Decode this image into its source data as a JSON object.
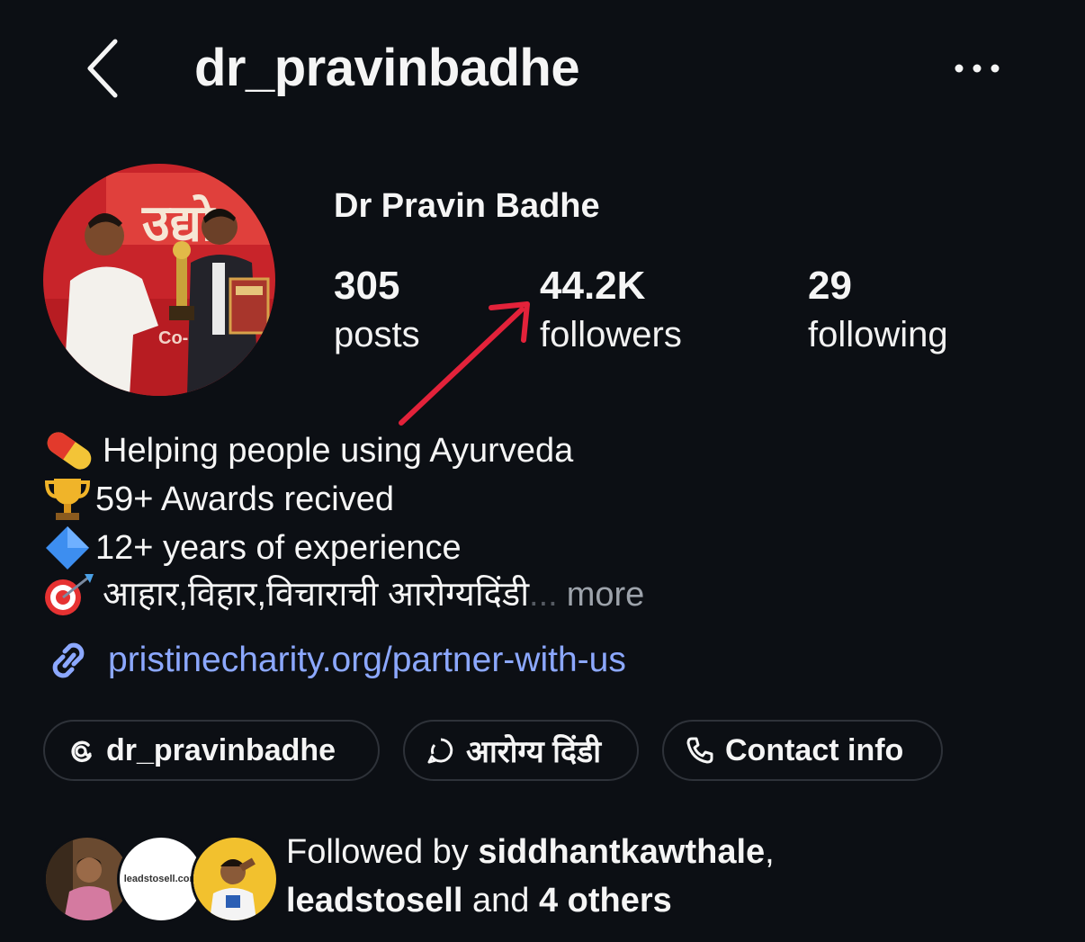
{
  "header": {
    "username": "dr_pravinbadhe"
  },
  "profile": {
    "display_name": "Dr Pravin Badhe",
    "stats": {
      "posts_count": "305",
      "posts_label": "posts",
      "followers_count": "44.2K",
      "followers_label": "followers",
      "following_count": "29",
      "following_label": "following"
    },
    "bio": {
      "line1": "Helping people using Ayurveda",
      "line2": "59+ Awards recived",
      "line3": "12+ years of experience",
      "line4": "आहार,विहार,विचाराची आरोग्यदिंडी",
      "ellipsis": "...",
      "more": "more"
    },
    "link": "pristinecharity.org/partner-with-us"
  },
  "chips": {
    "threads": "dr_pravinbadhe",
    "channel": "आरोग्य दिंडी",
    "contact": "Contact info"
  },
  "followed_by": {
    "prefix": "Followed by",
    "user1": "siddhantkawthale",
    "comma": ",",
    "user2": "leadstosell",
    "and": "and",
    "others": "4 others",
    "avatar2_text": "leadstosell.com"
  },
  "colors": {
    "background": "#0c0f14",
    "link": "#8ca8ff",
    "annotation_arrow": "#e3223a"
  }
}
